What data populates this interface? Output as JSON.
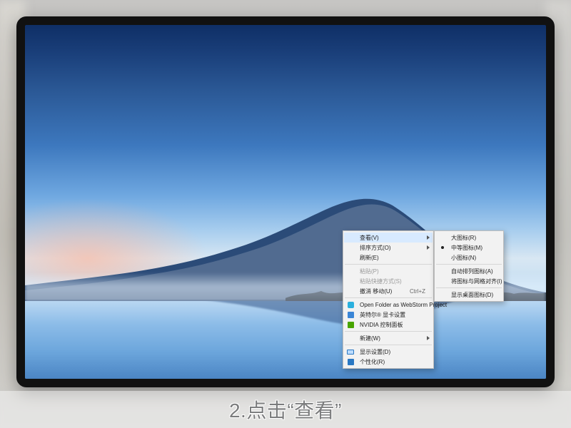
{
  "caption": "2.点击“查看”",
  "context_menu": {
    "items": [
      {
        "label": "查看(V)",
        "submenu": true,
        "hover": true
      },
      {
        "label": "排序方式(O)",
        "submenu": true
      },
      {
        "label": "刷新(E)"
      },
      {
        "sep": true
      },
      {
        "label": "粘贴(P)",
        "disabled": true
      },
      {
        "label": "粘贴快捷方式(S)",
        "disabled": true
      },
      {
        "label": "撤消 移动(U)",
        "shortcut": "Ctrl+Z"
      },
      {
        "sep": true
      },
      {
        "label": "Open Folder as WebStorm Project",
        "icon": "ws"
      },
      {
        "label": "英特尔® 显卡设置",
        "icon": "refresh"
      },
      {
        "label": "NVIDIA 控制面板",
        "icon": "nvidia"
      },
      {
        "sep": true
      },
      {
        "label": "新建(W)",
        "submenu": true
      },
      {
        "sep": true
      },
      {
        "label": "显示设置(D)",
        "icon": "display"
      },
      {
        "label": "个性化(R)",
        "icon": "personal"
      }
    ]
  },
  "view_submenu": {
    "items": [
      {
        "label": "大图标(R)"
      },
      {
        "label": "中等图标(M)",
        "selected": true
      },
      {
        "label": "小图标(N)"
      },
      {
        "sep": true
      },
      {
        "label": "自动排列图标(A)"
      },
      {
        "label": "将图标与网格对齐(I)"
      },
      {
        "sep": true
      },
      {
        "label": "显示桌面图标(D)"
      }
    ]
  }
}
